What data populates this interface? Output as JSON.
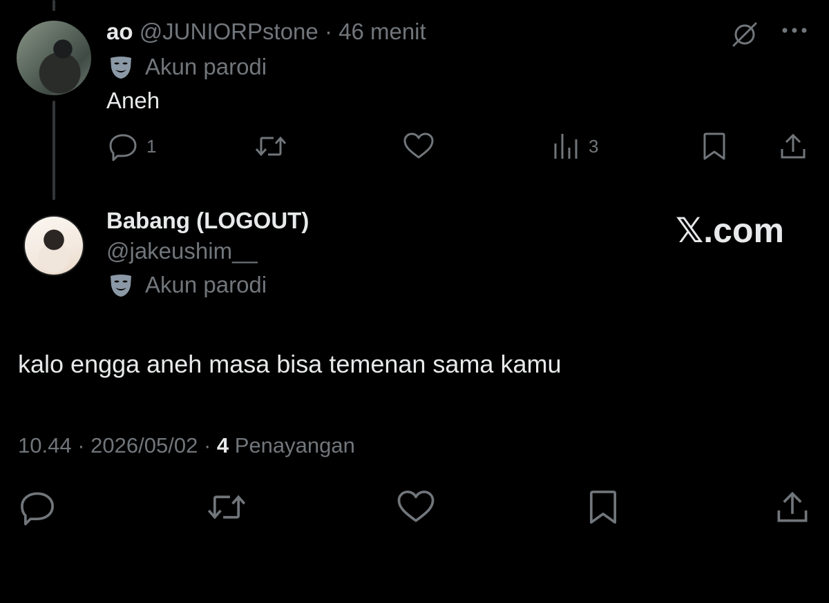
{
  "reply_tweet": {
    "display_name": "ao",
    "handle": "@JUNIORPstone",
    "separator": "·",
    "time_ago": "46 menit",
    "parody_label": "Akun parodi",
    "text": "Aneh",
    "actions": {
      "reply_count": "1",
      "retweet_count": "",
      "like_count": "",
      "views_count": "3"
    }
  },
  "main_tweet": {
    "display_name": "Babang (LOGOUT)",
    "handle": "@jakeushim__",
    "parody_label": "Akun parodi",
    "watermark": "𝕏.com",
    "text": "kalo engga aneh masa bisa temenan sama kamu",
    "time": "10.44",
    "separator": "·",
    "date": "2026/05/02",
    "views_count": "4",
    "views_label": "Penayangan"
  },
  "icons": [
    "parody-mask-icon",
    "no-link-icon",
    "more-icon",
    "reply-icon",
    "retweet-icon",
    "like-icon",
    "views-icon",
    "bookmark-icon",
    "share-icon"
  ],
  "colors": {
    "background": "#000000",
    "text": "#e7e9ea",
    "muted": "#71767b",
    "thread_line": "#333639"
  }
}
